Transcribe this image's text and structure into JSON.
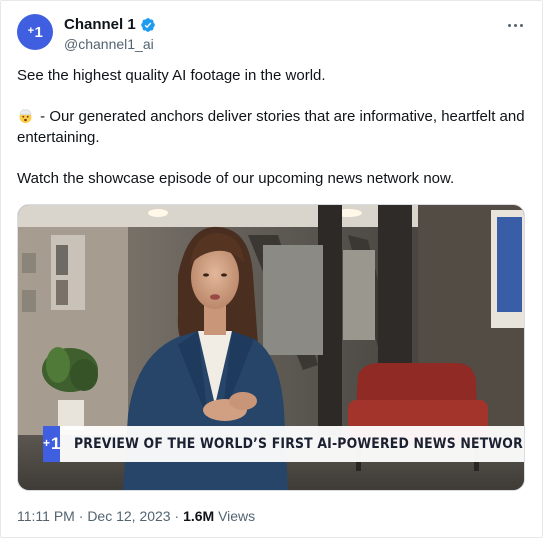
{
  "author": {
    "display_name": "Channel 1",
    "handle": "@channel1_ai",
    "avatar_text": "1",
    "avatar_color": "#3f5ee0",
    "verified": true,
    "verified_color": "#1d9bf0"
  },
  "post": {
    "line1": "See the highest quality AI footage in the world.",
    "line2": " - Our generated anchors deliver stories that are informative, heartfelt and entertaining.",
    "line2_emoji": "exploding-head-emoji",
    "line3": "Watch the showcase episode of our upcoming news network now."
  },
  "media": {
    "logo_text": "1",
    "headline": "PREVIEW OF THE WORLD’S FIRST AI-POWERED NEWS NETWORK",
    "accent": "#3f5ee0"
  },
  "meta": {
    "time": "11:11 PM",
    "separator": "·",
    "date": "Dec 12, 2023",
    "views_count": "1.6M",
    "views_label": "Views"
  }
}
